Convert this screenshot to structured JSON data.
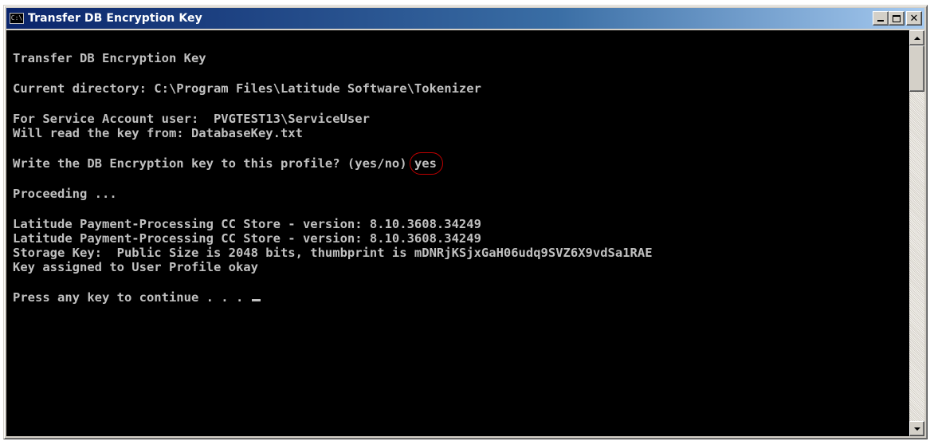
{
  "window": {
    "title": "Transfer DB Encryption Key",
    "icon": "console-icon",
    "icon_text": "C:\\"
  },
  "colors": {
    "titlebar_start": "#0a246a",
    "console_bg": "#000000",
    "console_text": "#c0c0c0",
    "highlight_circle": "#c00000"
  },
  "console": {
    "lines": [
      "Transfer DB Encryption Key",
      "Current directory: C:\\Program Files\\Latitude Software\\Tokenizer",
      "For Service Account user:  PVGTEST13\\ServiceUser",
      "Will read the key from: DatabaseKey.txt",
      "Write the DB Encryption key to this profile? (yes/no)",
      "Proceeding ...",
      "Latitude Payment-Processing CC Store - version: 8.10.3608.34249",
      "Latitude Payment-Processing CC Store - version: 8.10.3608.34249",
      "Storage Key:  Public Size is 2048 bits, thumbprint is mDNRjKSjxGaH06udq9SVZ6X9vdSa1RAE",
      "Key assigned to User Profile okay",
      "Press any key to continue . . . "
    ],
    "answer": "yes"
  }
}
